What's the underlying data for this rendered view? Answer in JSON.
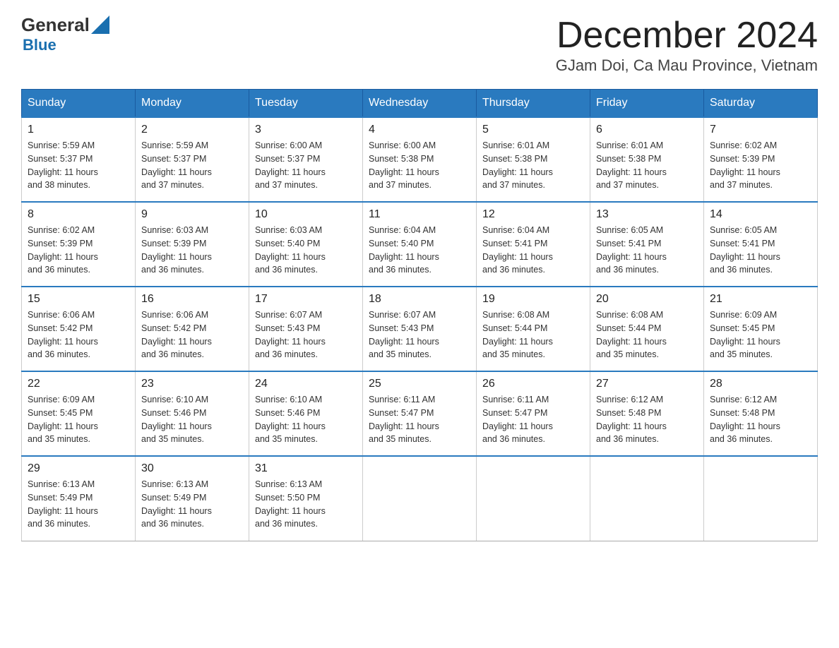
{
  "logo": {
    "general": "General",
    "blue": "Blue"
  },
  "title": "December 2024",
  "subtitle": "GJam Doi, Ca Mau Province, Vietnam",
  "days": [
    "Sunday",
    "Monday",
    "Tuesday",
    "Wednesday",
    "Thursday",
    "Friday",
    "Saturday"
  ],
  "weeks": [
    [
      {
        "day": 1,
        "sunrise": "5:59 AM",
        "sunset": "5:37 PM",
        "daylight": "11 hours and 38 minutes."
      },
      {
        "day": 2,
        "sunrise": "5:59 AM",
        "sunset": "5:37 PM",
        "daylight": "11 hours and 37 minutes."
      },
      {
        "day": 3,
        "sunrise": "6:00 AM",
        "sunset": "5:37 PM",
        "daylight": "11 hours and 37 minutes."
      },
      {
        "day": 4,
        "sunrise": "6:00 AM",
        "sunset": "5:38 PM",
        "daylight": "11 hours and 37 minutes."
      },
      {
        "day": 5,
        "sunrise": "6:01 AM",
        "sunset": "5:38 PM",
        "daylight": "11 hours and 37 minutes."
      },
      {
        "day": 6,
        "sunrise": "6:01 AM",
        "sunset": "5:38 PM",
        "daylight": "11 hours and 37 minutes."
      },
      {
        "day": 7,
        "sunrise": "6:02 AM",
        "sunset": "5:39 PM",
        "daylight": "11 hours and 37 minutes."
      }
    ],
    [
      {
        "day": 8,
        "sunrise": "6:02 AM",
        "sunset": "5:39 PM",
        "daylight": "11 hours and 36 minutes."
      },
      {
        "day": 9,
        "sunrise": "6:03 AM",
        "sunset": "5:39 PM",
        "daylight": "11 hours and 36 minutes."
      },
      {
        "day": 10,
        "sunrise": "6:03 AM",
        "sunset": "5:40 PM",
        "daylight": "11 hours and 36 minutes."
      },
      {
        "day": 11,
        "sunrise": "6:04 AM",
        "sunset": "5:40 PM",
        "daylight": "11 hours and 36 minutes."
      },
      {
        "day": 12,
        "sunrise": "6:04 AM",
        "sunset": "5:41 PM",
        "daylight": "11 hours and 36 minutes."
      },
      {
        "day": 13,
        "sunrise": "6:05 AM",
        "sunset": "5:41 PM",
        "daylight": "11 hours and 36 minutes."
      },
      {
        "day": 14,
        "sunrise": "6:05 AM",
        "sunset": "5:41 PM",
        "daylight": "11 hours and 36 minutes."
      }
    ],
    [
      {
        "day": 15,
        "sunrise": "6:06 AM",
        "sunset": "5:42 PM",
        "daylight": "11 hours and 36 minutes."
      },
      {
        "day": 16,
        "sunrise": "6:06 AM",
        "sunset": "5:42 PM",
        "daylight": "11 hours and 36 minutes."
      },
      {
        "day": 17,
        "sunrise": "6:07 AM",
        "sunset": "5:43 PM",
        "daylight": "11 hours and 36 minutes."
      },
      {
        "day": 18,
        "sunrise": "6:07 AM",
        "sunset": "5:43 PM",
        "daylight": "11 hours and 35 minutes."
      },
      {
        "day": 19,
        "sunrise": "6:08 AM",
        "sunset": "5:44 PM",
        "daylight": "11 hours and 35 minutes."
      },
      {
        "day": 20,
        "sunrise": "6:08 AM",
        "sunset": "5:44 PM",
        "daylight": "11 hours and 35 minutes."
      },
      {
        "day": 21,
        "sunrise": "6:09 AM",
        "sunset": "5:45 PM",
        "daylight": "11 hours and 35 minutes."
      }
    ],
    [
      {
        "day": 22,
        "sunrise": "6:09 AM",
        "sunset": "5:45 PM",
        "daylight": "11 hours and 35 minutes."
      },
      {
        "day": 23,
        "sunrise": "6:10 AM",
        "sunset": "5:46 PM",
        "daylight": "11 hours and 35 minutes."
      },
      {
        "day": 24,
        "sunrise": "6:10 AM",
        "sunset": "5:46 PM",
        "daylight": "11 hours and 35 minutes."
      },
      {
        "day": 25,
        "sunrise": "6:11 AM",
        "sunset": "5:47 PM",
        "daylight": "11 hours and 35 minutes."
      },
      {
        "day": 26,
        "sunrise": "6:11 AM",
        "sunset": "5:47 PM",
        "daylight": "11 hours and 36 minutes."
      },
      {
        "day": 27,
        "sunrise": "6:12 AM",
        "sunset": "5:48 PM",
        "daylight": "11 hours and 36 minutes."
      },
      {
        "day": 28,
        "sunrise": "6:12 AM",
        "sunset": "5:48 PM",
        "daylight": "11 hours and 36 minutes."
      }
    ],
    [
      {
        "day": 29,
        "sunrise": "6:13 AM",
        "sunset": "5:49 PM",
        "daylight": "11 hours and 36 minutes."
      },
      {
        "day": 30,
        "sunrise": "6:13 AM",
        "sunset": "5:49 PM",
        "daylight": "11 hours and 36 minutes."
      },
      {
        "day": 31,
        "sunrise": "6:13 AM",
        "sunset": "5:50 PM",
        "daylight": "11 hours and 36 minutes."
      },
      null,
      null,
      null,
      null
    ]
  ],
  "labels": {
    "sunrise": "Sunrise:",
    "sunset": "Sunset:",
    "daylight": "Daylight:"
  }
}
